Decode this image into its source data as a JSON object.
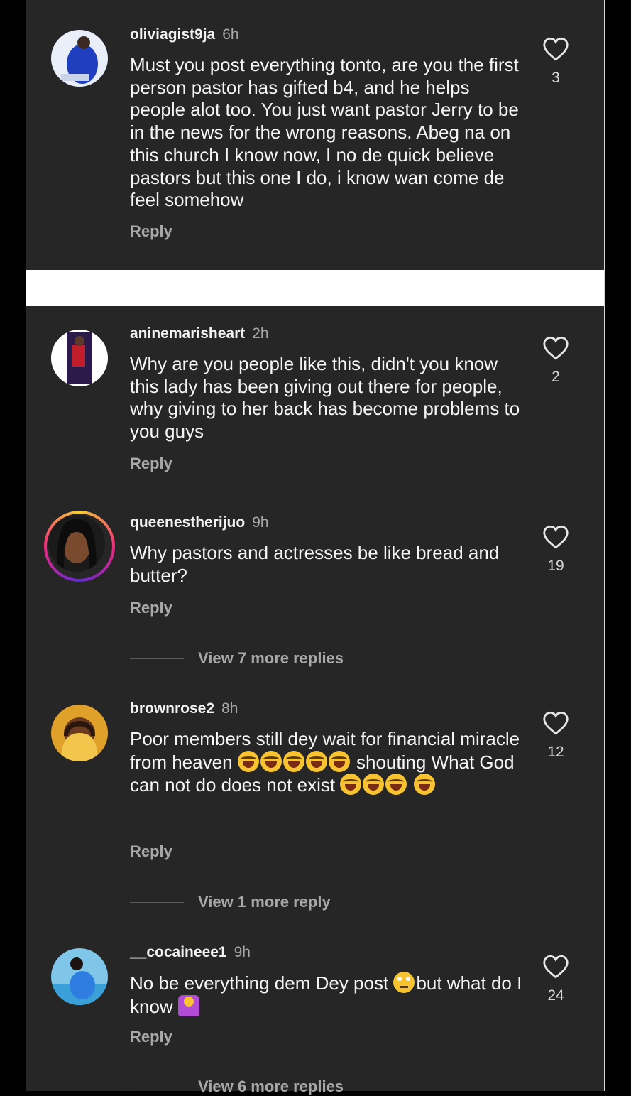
{
  "comments": [
    {
      "username": "oliviagist9ja",
      "time": "6h",
      "text": "Must you post everything tonto, are you the first person pastor has gifted b4, and he helps people alot too. You just want pastor Jerry to be in the news for the wrong reasons. Abeg na on this church I know now, I no de quick believe pastors but this one I do, i know wan come de feel somehow",
      "likes": "3",
      "reply_label": "Reply"
    },
    {
      "username": "aninemarisheart",
      "time": "2h",
      "text": "Why are you people like this, didn't you know this lady has been giving out there for people, why giving to her back has become problems to you guys",
      "likes": "2",
      "reply_label": "Reply"
    },
    {
      "username": "queenestherijuo",
      "time": "9h",
      "text": "Why pastors and actresses be like bread and butter?",
      "likes": "19",
      "reply_label": "Reply",
      "more_replies": "View 7 more replies"
    },
    {
      "username": "brownrose2",
      "time": "8h",
      "text_part1": "Poor members still dey wait for financial miracle from heaven",
      "text_part2": "shouting What God can not do does not exist",
      "likes": "12",
      "reply_label": "Reply",
      "more_replies": "View 1 more reply"
    },
    {
      "username": "__cocaineee1",
      "time": "9h",
      "text_part1": "No be everything dem Dey post",
      "text_part2": "but what do I know",
      "likes": "24",
      "reply_label": "Reply",
      "more_replies": "View 6 more replies"
    }
  ],
  "icons": {
    "like": "heart-outline-icon",
    "laugh": "face-with-tears-of-joy-emoji",
    "eyeroll": "face-with-rolling-eyes-emoji",
    "shrug": "person-shrugging-emoji"
  },
  "colors": {
    "panel_bg": "#262626",
    "text": "#f5f5f5",
    "muted": "#a8a8a8"
  }
}
